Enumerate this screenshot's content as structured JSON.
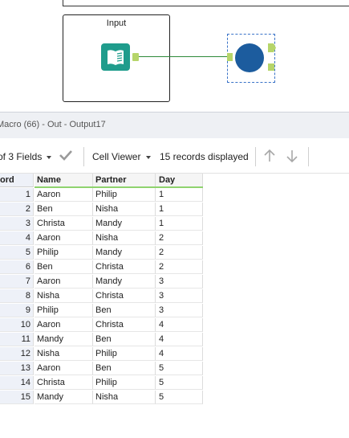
{
  "canvas": {
    "container_title": "Input"
  },
  "results": {
    "title": "Macro (66) - Out - Output17",
    "toolbar": {
      "fields_label": "of 3 Fields",
      "cell_viewer_label": "Cell Viewer",
      "records_label": "15 records displayed"
    },
    "columns": [
      "ord",
      "Name",
      "Partner",
      "Day"
    ],
    "rows": [
      {
        "rec": "1",
        "name": "Aaron",
        "partner": "Philip",
        "day": "1"
      },
      {
        "rec": "2",
        "name": "Ben",
        "partner": "Nisha",
        "day": "1"
      },
      {
        "rec": "3",
        "name": "Christa",
        "partner": "Mandy",
        "day": "1"
      },
      {
        "rec": "4",
        "name": "Aaron",
        "partner": "Nisha",
        "day": "2"
      },
      {
        "rec": "5",
        "name": "Philip",
        "partner": "Mandy",
        "day": "2"
      },
      {
        "rec": "6",
        "name": "Ben",
        "partner": "Christa",
        "day": "2"
      },
      {
        "rec": "7",
        "name": "Aaron",
        "partner": "Mandy",
        "day": "3"
      },
      {
        "rec": "8",
        "name": "Nisha",
        "partner": "Christa",
        "day": "3"
      },
      {
        "rec": "9",
        "name": "Philip",
        "partner": "Ben",
        "day": "3"
      },
      {
        "rec": "10",
        "name": "Aaron",
        "partner": "Christa",
        "day": "4"
      },
      {
        "rec": "11",
        "name": "Mandy",
        "partner": "Ben",
        "day": "4"
      },
      {
        "rec": "12",
        "name": "Nisha",
        "partner": "Philip",
        "day": "4"
      },
      {
        "rec": "13",
        "name": "Aaron",
        "partner": "Ben",
        "day": "5"
      },
      {
        "rec": "14",
        "name": "Christa",
        "partner": "Philip",
        "day": "5"
      },
      {
        "rec": "15",
        "name": "Mandy",
        "partner": "Nisha",
        "day": "5"
      }
    ]
  }
}
